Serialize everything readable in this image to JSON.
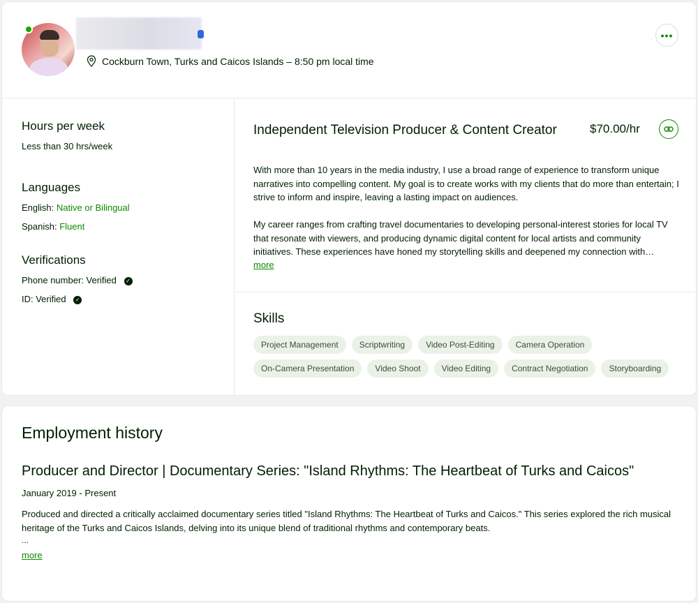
{
  "profile": {
    "location": "Cockburn Town, Turks and Caicos Islands – 8:50 pm local time",
    "icons": {
      "location": "location-pin-icon",
      "more": "more-options-icon",
      "link": "link-icon"
    }
  },
  "sidebar": {
    "hours": {
      "title": "Hours per week",
      "value": "Less than 30 hrs/week"
    },
    "languages": {
      "title": "Languages",
      "items": [
        {
          "language": "English:",
          "level": "Native or Bilingual"
        },
        {
          "language": "Spanish:",
          "level": "Fluent"
        }
      ]
    },
    "verifications": {
      "title": "Verifications",
      "items": [
        {
          "label": "Phone number: Verified"
        },
        {
          "label": "ID: Verified"
        }
      ]
    }
  },
  "main": {
    "title": "Independent Television Producer & Content Creator",
    "rate": "$70.00/hr",
    "overview_p1": "With more than 10 years in the media industry, I use a broad range of experience to transform unique narratives into compelling content. My goal is to create works with my clients that do more than entertain; I strive to inform and inspire, leaving a lasting impact on audiences.",
    "overview_p2": "My career ranges from crafting travel documentaries to developing personal-interest stories for local TV that resonate with viewers, and producing dynamic digital content for local artists and community initiatives. These experiences have honed my storytelling skills and deepened my connection with…",
    "more_label": "more",
    "skills_title": "Skills",
    "skills": [
      "Project Management",
      "Scriptwriting",
      "Video Post-Editing",
      "Camera Operation",
      "On-Camera Presentation",
      "Video Shoot",
      "Video Editing",
      "Contract Negotiation",
      "Storyboarding"
    ]
  },
  "employment": {
    "title": "Employment history",
    "role": "Producer and Director | Documentary Series: \"Island Rhythms: The Heartbeat of Turks and Caicos\"",
    "dates": "January 2019 - Present",
    "description": "Produced and directed a critically acclaimed documentary series titled \"Island Rhythms: The Heartbeat of Turks and Caicos.\" This series explored the rich musical heritage of the Turks and Caicos Islands, delving into its unique blend of traditional rhythms and contemporary beats.",
    "ellipsis": "...",
    "more_label": "more"
  },
  "colors": {
    "accent": "#108a00",
    "text": "#001e00",
    "chip": "#eaf2e8",
    "online": "#14a800"
  }
}
